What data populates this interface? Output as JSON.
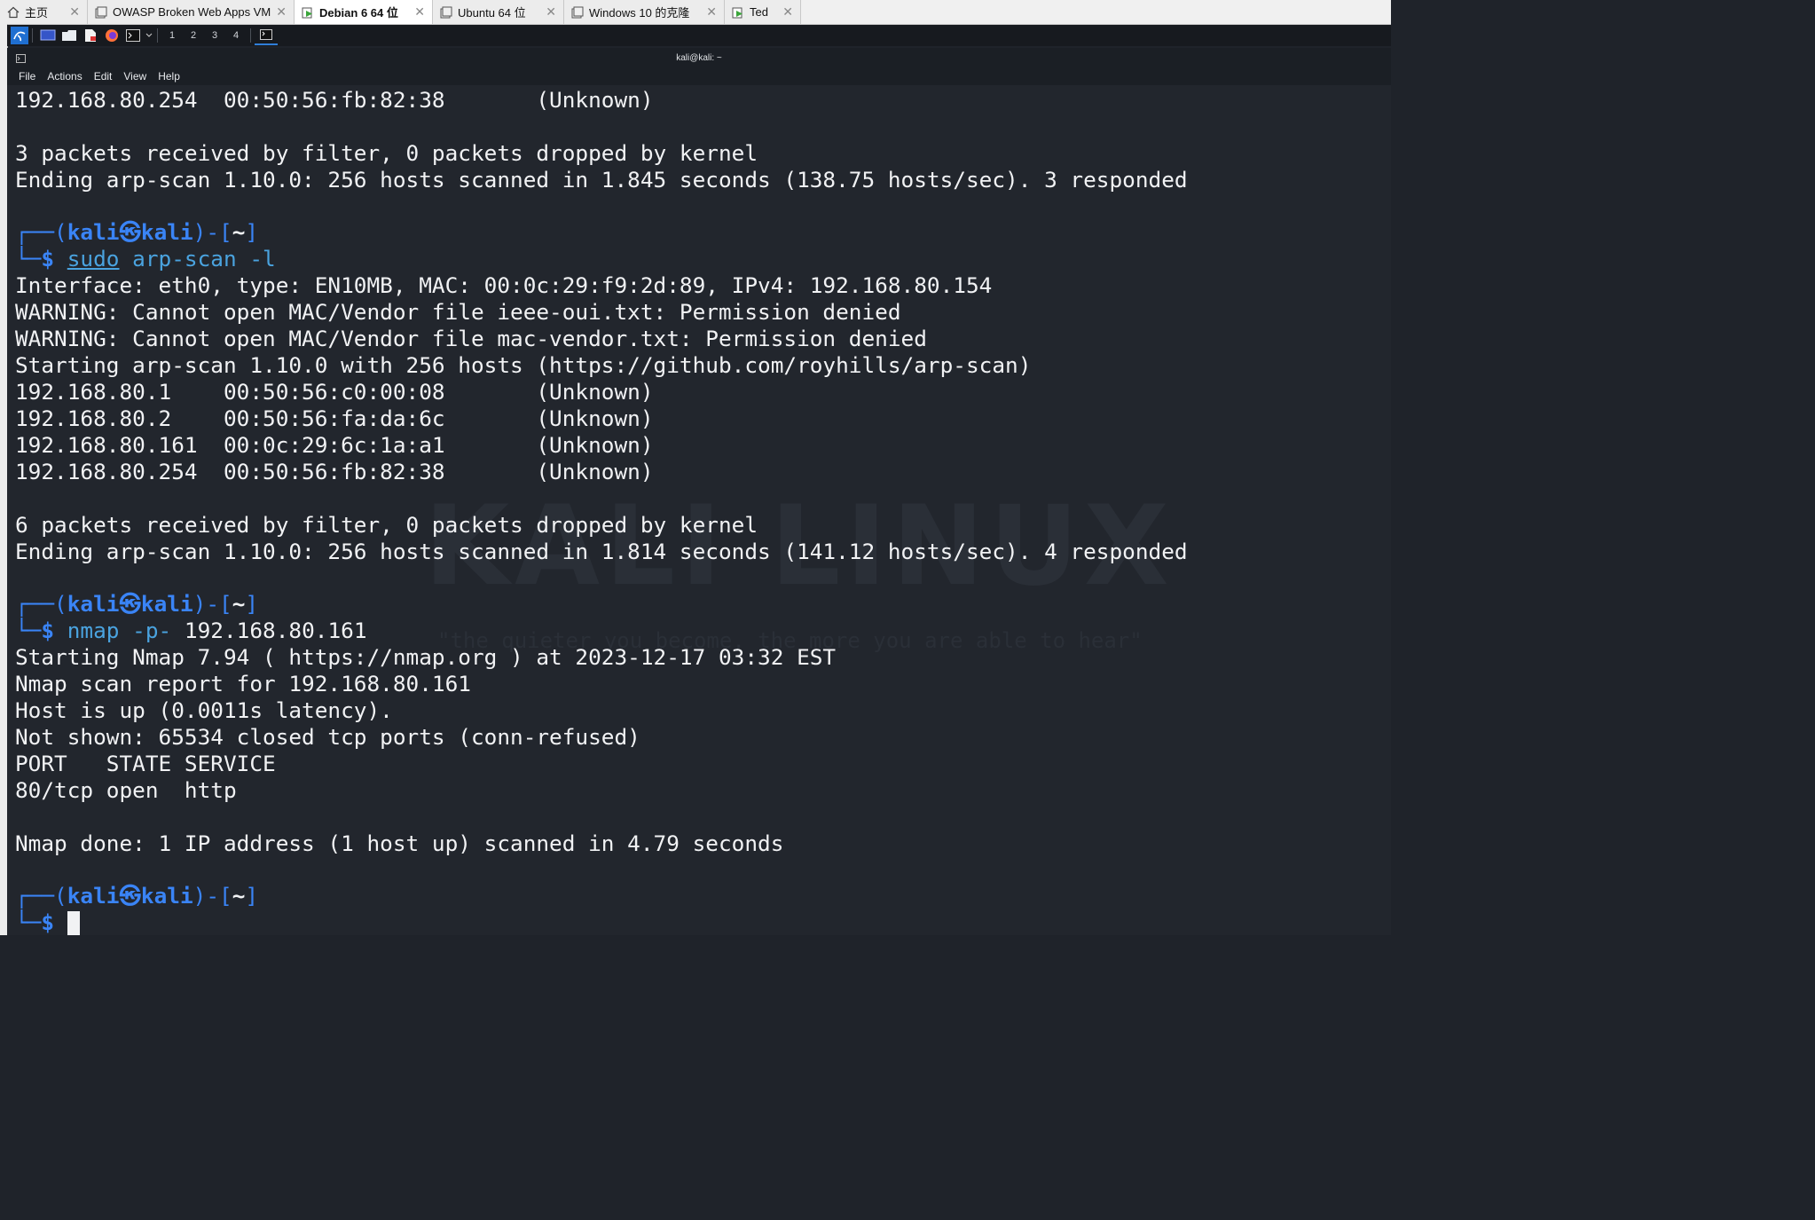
{
  "vm_tabs": [
    {
      "label": "主页",
      "icon": "home-icon",
      "active": false
    },
    {
      "label": "OWASP Broken Web Apps VM ...",
      "icon": "vm-icon",
      "active": false
    },
    {
      "label": "Debian 6 64 位",
      "icon": "vm-running-icon",
      "active": true
    },
    {
      "label": "Ubuntu 64 位",
      "icon": "vm-icon",
      "active": false
    },
    {
      "label": "Windows 10 的克隆",
      "icon": "vm-icon",
      "active": false
    },
    {
      "label": "Ted",
      "icon": "vm-running-icon",
      "active": false
    }
  ],
  "panel": {
    "workspaces": [
      "1",
      "2",
      "3",
      "4"
    ],
    "icons": [
      "kali-menu-icon",
      "desktop-icon",
      "file-manager-icon",
      "text-editor-icon",
      "firefox-icon",
      "terminal-icon",
      "chevron-down-icon",
      "terminal-window-icon"
    ]
  },
  "window": {
    "title": "kali@kali: ~"
  },
  "menu": [
    "File",
    "Actions",
    "Edit",
    "View",
    "Help"
  ],
  "watermark": {
    "big": "KALI LINUX",
    "tagline": "\"the quieter you become, the more you are able to hear\""
  },
  "prompt": {
    "user": "kali",
    "host": "kali",
    "path": "~",
    "symbol": "$"
  },
  "terminal": {
    "l0": "192.168.80.254  00:50:56:fb:82:38       (Unknown)",
    "l1": "3 packets received by filter, 0 packets dropped by kernel",
    "l2": "Ending arp-scan 1.10.0: 256 hosts scanned in 1.845 seconds (138.75 hosts/sec). 3 responded",
    "cmd1_sudo": "sudo",
    "cmd1_rest": " arp-scan -l",
    "l3": "Interface: eth0, type: EN10MB, MAC: 00:0c:29:f9:2d:89, IPv4: 192.168.80.154",
    "l4": "WARNING: Cannot open MAC/Vendor file ieee-oui.txt: Permission denied",
    "l5": "WARNING: Cannot open MAC/Vendor file mac-vendor.txt: Permission denied",
    "l6": "Starting arp-scan 1.10.0 with 256 hosts (https://github.com/royhills/arp-scan)",
    "l7": "192.168.80.1    00:50:56:c0:00:08       (Unknown)",
    "l8": "192.168.80.2    00:50:56:fa:da:6c       (Unknown)",
    "l9": "192.168.80.161  00:0c:29:6c:1a:a1       (Unknown)",
    "l10": "192.168.80.254  00:50:56:fb:82:38       (Unknown)",
    "l11": "6 packets received by filter, 0 packets dropped by kernel",
    "l12": "Ending arp-scan 1.10.0: 256 hosts scanned in 1.814 seconds (141.12 hosts/sec). 4 responded",
    "cmd2": "nmap -p-",
    "cmd2_arg": " 192.168.80.161",
    "l13": "Starting Nmap 7.94 ( https://nmap.org ) at 2023-12-17 03:32 EST",
    "l14": "Nmap scan report for 192.168.80.161",
    "l15": "Host is up (0.0011s latency).",
    "l16": "Not shown: 65534 closed tcp ports (conn-refused)",
    "l17": "PORT   STATE SERVICE",
    "l18": "80/tcp open  http",
    "l19": "Nmap done: 1 IP address (1 host up) scanned in 4.79 seconds"
  },
  "colors": {
    "prompt": "#3a84f6",
    "command": "#4aa3df",
    "background": "#22262d",
    "text": "#f1f2f4"
  }
}
